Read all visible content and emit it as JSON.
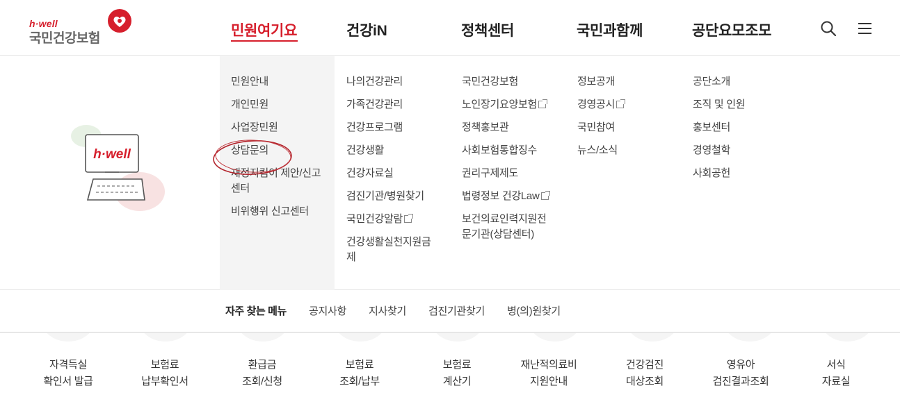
{
  "header": {
    "logo": {
      "tagline": "h·well",
      "name": "국민건강보험"
    },
    "nav": [
      "민원여기요",
      "건강iN",
      "정책센터",
      "국민과함께",
      "공단요모조모"
    ],
    "active_nav": "민원여기요",
    "icons": [
      "search-icon",
      "menu-icon"
    ]
  },
  "illustration": {
    "screen_text": "h·well"
  },
  "mega_menu": {
    "col1": [
      "민원안내",
      "개인민원",
      "사업장민원",
      "상담문의",
      "재정지킴이 제안/신고센터",
      "비위행위 신고센터"
    ],
    "col2": [
      "나의건강관리",
      "가족건강관리",
      "건강프로그램",
      "건강생활",
      "건강자료실",
      "검진기관/병원찾기",
      "국민건강알람",
      "건강생활실천지원금제"
    ],
    "col3": [
      "국민건강보험",
      "노인장기요양보험",
      "정책홍보관",
      "사회보험통합징수",
      "권리구제제도",
      "법령정보 건강Law",
      "보건의료인력지원전문기관(상담센터)"
    ],
    "col4": [
      "정보공개",
      "경영공시",
      "국민참여",
      "뉴스/소식"
    ],
    "col5": [
      "공단소개",
      "조직 및 인원",
      "홍보센터",
      "경영철학",
      "사회공헌"
    ]
  },
  "quick_menu": {
    "title": "자주 찾는 메뉴",
    "links": [
      "공지사항",
      "지사찾기",
      "검진기관찾기",
      "병(의)원찾기"
    ]
  },
  "services": [
    {
      "line1": "자격득실",
      "line2": "확인서 발급"
    },
    {
      "line1": "보험료",
      "line2": "납부확인서"
    },
    {
      "line1": "환급금",
      "line2": "조회/신청"
    },
    {
      "line1": "보험료",
      "line2": "조회/납부"
    },
    {
      "line1": "보험료",
      "line2": "계산기"
    },
    {
      "line1": "재난적의료비",
      "line2": "지원안내"
    },
    {
      "line1": "건강검진",
      "line2": "대상조회"
    },
    {
      "line1": "영유아",
      "line2": "검진결과조회"
    },
    {
      "line1": "서식",
      "line2": "자료실"
    }
  ],
  "colors": {
    "brand_red": "#d61f2c",
    "text": "#333333",
    "panel_gray": "#f4f4f4"
  }
}
